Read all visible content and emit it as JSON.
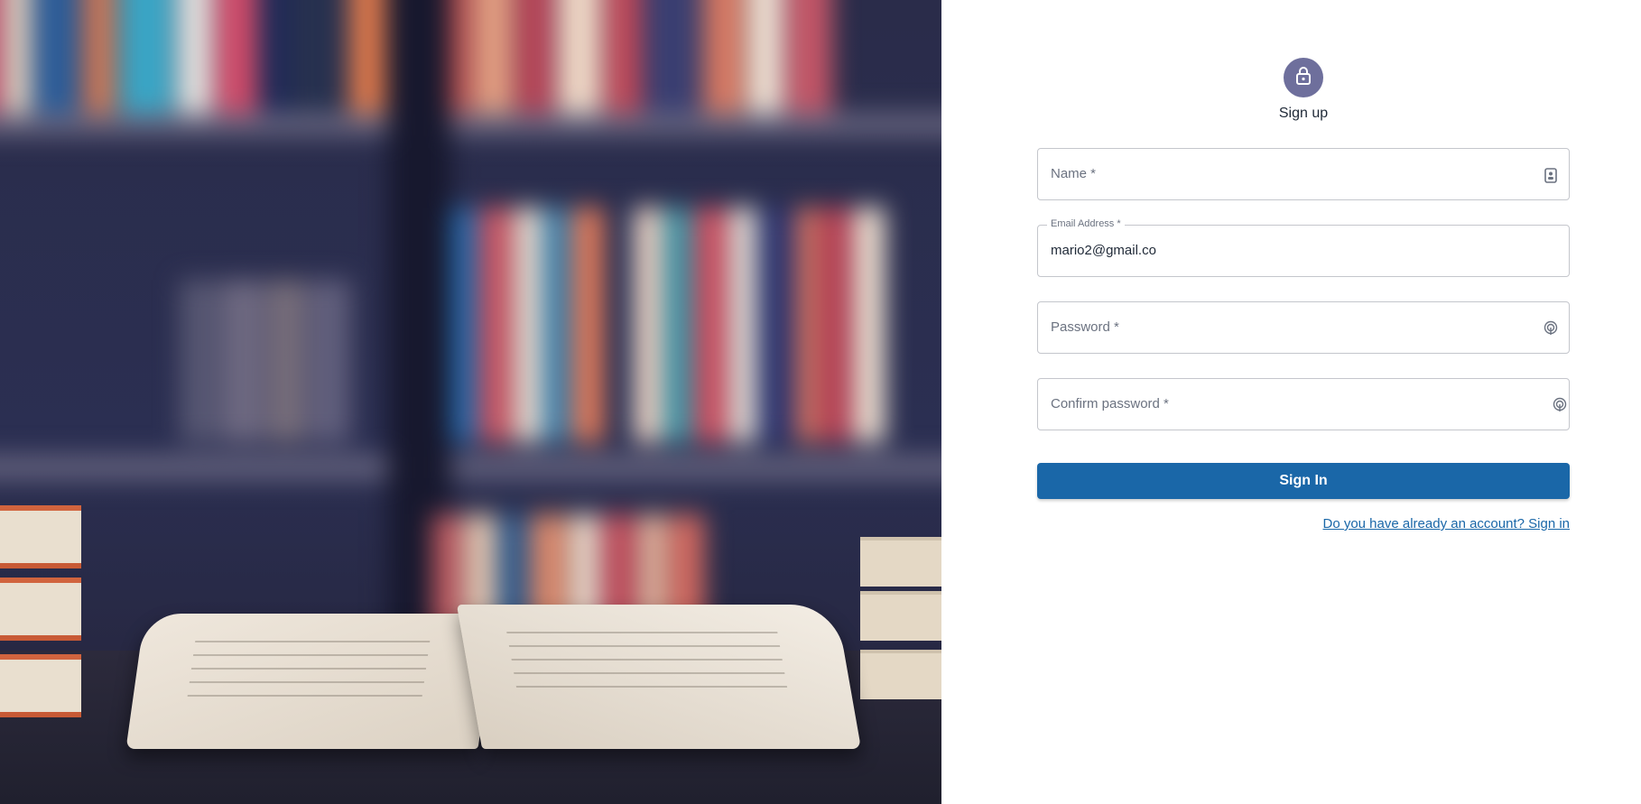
{
  "hero": {
    "image_name": "library-bookshelf-photo"
  },
  "form": {
    "title": "Sign up",
    "icon": "lock-icon",
    "fields": {
      "name": {
        "label": "Name *",
        "value": "",
        "icon": "contact-card-icon"
      },
      "email": {
        "label": "Email Address *",
        "value": "mario2@gmail.co"
      },
      "password": {
        "label": "Password *",
        "value": "",
        "icon": "fingerprint-icon"
      },
      "confirm_password": {
        "label": "Confirm password *",
        "value": "",
        "icon": "fingerprint-icon"
      }
    },
    "submit_label": "Sign In",
    "signin_link": "Do you have already an account? Sign in"
  },
  "colors": {
    "primary": "#1a67a8",
    "avatar_bg": "#6e6f9c",
    "border": "#c4c6cc"
  }
}
